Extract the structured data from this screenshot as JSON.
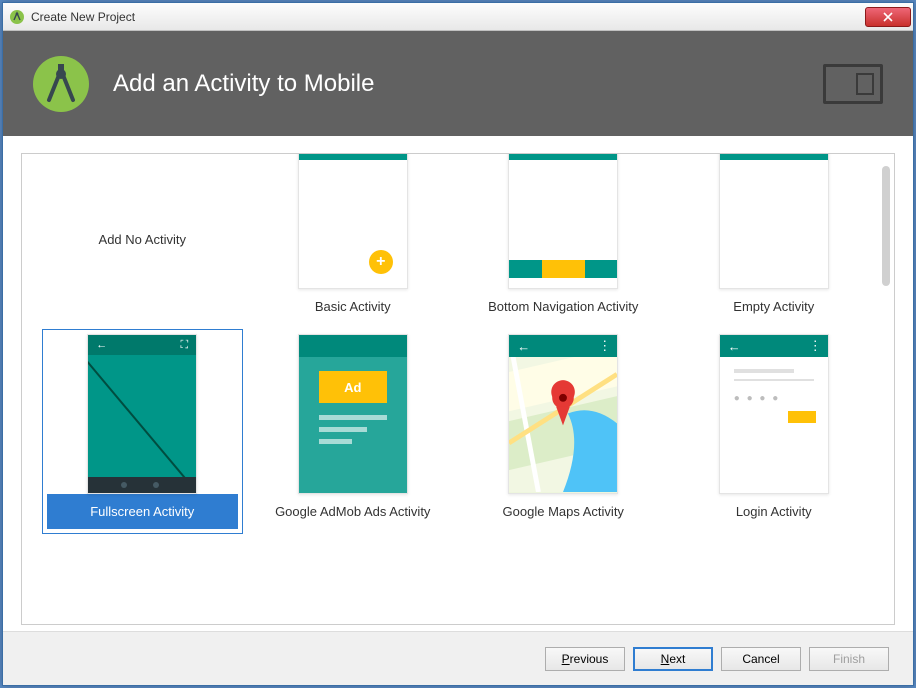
{
  "window": {
    "title": "Create New Project"
  },
  "banner": {
    "heading": "Add an Activity to Mobile"
  },
  "templates": [
    {
      "id": "no-activity",
      "label": "Add No Activity",
      "no_thumb": true
    },
    {
      "id": "basic",
      "label": "Basic Activity"
    },
    {
      "id": "bottom-nav",
      "label": "Bottom Navigation Activity"
    },
    {
      "id": "empty",
      "label": "Empty Activity"
    },
    {
      "id": "fullscreen",
      "label": "Fullscreen Activity",
      "selected": true
    },
    {
      "id": "admob",
      "label": "Google AdMob Ads Activity"
    },
    {
      "id": "gmaps",
      "label": "Google Maps Activity"
    },
    {
      "id": "login",
      "label": "Login Activity"
    }
  ],
  "admob_ad_label": "Ad",
  "fullscreen_icons": {
    "back": "←",
    "expand": "⛶"
  },
  "appbar_icons": {
    "back": "←",
    "overflow": "⋮"
  },
  "buttons": {
    "previous": {
      "label": "Previous",
      "hotkey_index": 0
    },
    "next": {
      "label": "Next",
      "hotkey_index": 0
    },
    "cancel": {
      "label": "Cancel"
    },
    "finish": {
      "label": "Finish",
      "disabled": true
    }
  },
  "fab_glyph": "+"
}
